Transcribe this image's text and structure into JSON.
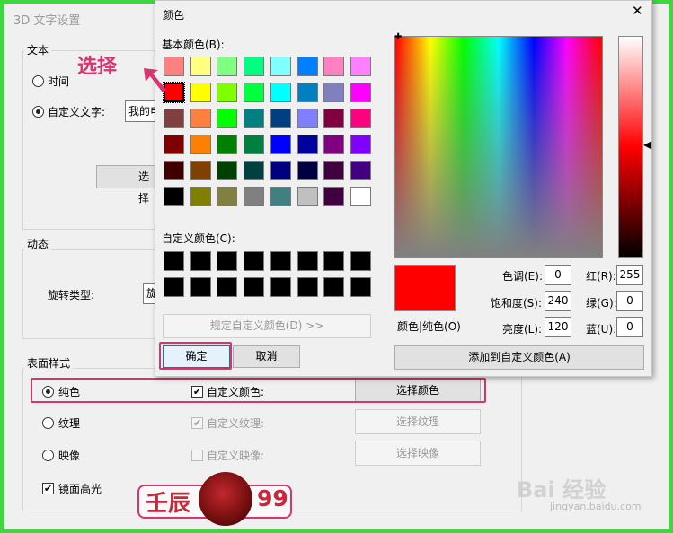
{
  "background_dialog": {
    "title": "3D 文字设置",
    "text_group": {
      "label": "文本",
      "time_label": "时间",
      "custom_text_label": "自定义文字:",
      "custom_text_value": "我的电",
      "select_font_button": "选择"
    },
    "motion_group": {
      "label": "动态",
      "rotation_type_label": "旋转类型:",
      "rotation_value": "旋"
    },
    "surface_group": {
      "label": "表面样式",
      "solid_label": "纯色",
      "custom_color_label": "自定义颜色:",
      "select_color_button": "选择颜色",
      "texture_label": "纹理",
      "custom_texture_label": "自定义纹理:",
      "select_texture_button": "选择纹理",
      "reflection_label": "映像",
      "custom_reflection_label": "自定义映像:",
      "select_reflection_button": "选择映像",
      "specular_label": "镜面高光"
    }
  },
  "color_dialog": {
    "title": "颜色",
    "close_glyph": "✕",
    "basic_colors_label": "基本颜色(B):",
    "basic_colors": [
      [
        "#ff8080",
        "#ffff80",
        "#80ff80",
        "#00ff80",
        "#80ffff",
        "#0080ff",
        "#ff80c0",
        "#ff80ff"
      ],
      [
        "#ff0000",
        "#ffff00",
        "#80ff00",
        "#00ff40",
        "#00ffff",
        "#0080c0",
        "#8080c0",
        "#ff00ff"
      ],
      [
        "#804040",
        "#ff8040",
        "#00ff00",
        "#008080",
        "#004080",
        "#8080ff",
        "#800040",
        "#ff0080"
      ],
      [
        "#800000",
        "#ff8000",
        "#008000",
        "#008040",
        "#0000ff",
        "#0000a0",
        "#800080",
        "#8000ff"
      ],
      [
        "#400000",
        "#804000",
        "#004000",
        "#004040",
        "#000080",
        "#000040",
        "#400040",
        "#400080"
      ],
      [
        "#000000",
        "#808000",
        "#808040",
        "#808080",
        "#408080",
        "#c0c0c0",
        "#400040",
        "#ffffff"
      ]
    ],
    "custom_colors_label": "自定义颜色(C):",
    "custom_colors": [
      [
        "#000000",
        "#000000",
        "#000000",
        "#000000",
        "#000000",
        "#000000",
        "#000000",
        "#000000"
      ],
      [
        "#000000",
        "#000000",
        "#000000",
        "#000000",
        "#000000",
        "#000000",
        "#000000",
        "#000000"
      ]
    ],
    "define_custom_button": "规定自定义颜色(D) >>",
    "ok_button": "确定",
    "cancel_button": "取消",
    "color_solid_label": "颜色|纯色(O)",
    "preview_color": "#ff0000",
    "hue_label": "色调(E):",
    "hue_value": "0",
    "sat_label": "饱和度(S):",
    "sat_value": "240",
    "lum_label": "亮度(L):",
    "lum_value": "120",
    "red_label": "红(R):",
    "red_value": "255",
    "green_label": "绿(G):",
    "green_value": "0",
    "blue_label": "蓝(U):",
    "blue_value": "0",
    "add_custom_button": "添加到自定义颜色(A)"
  },
  "annotation": {
    "select_text": "选择",
    "accent_color": "#d93370"
  },
  "watermarks": {
    "logo_left": "壬辰",
    "logo_right": "99",
    "baidu_text": "Bai 经验",
    "baidu_url": "jingyan.baidu.com"
  }
}
